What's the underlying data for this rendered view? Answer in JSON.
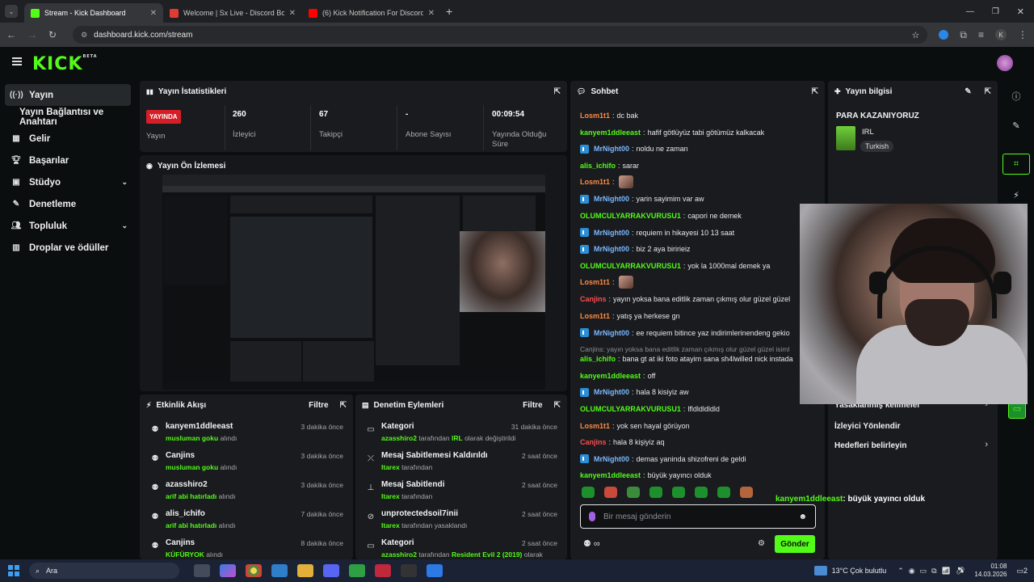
{
  "browser": {
    "tabs": [
      {
        "title": "Stream - Kick Dashboard",
        "icon": "kick-icon",
        "color": "#53fc18",
        "active": true
      },
      {
        "title": "Welcome | Sx Live - Discord Bot",
        "icon": "bot-icon",
        "color": "#e03c31",
        "active": false
      },
      {
        "title": "(6) Kick Notification For Discord",
        "icon": "youtube-icon",
        "color": "#ff0000",
        "active": false
      }
    ],
    "url": "dashboard.kick.com/stream"
  },
  "site": {
    "logo": "KICK",
    "logo_tag": "BETA",
    "accent": "#53fc18"
  },
  "sidebar": {
    "items": [
      {
        "label": "Yayın",
        "icon": "broadcast-icon"
      },
      {
        "label": "Yayın Bağlantısı ve Anahtarı",
        "icon": ""
      },
      {
        "label": "Gelir",
        "icon": "revenue-icon"
      },
      {
        "label": "Başarılar",
        "icon": "trophy-icon"
      },
      {
        "label": "Stüdyo",
        "icon": "studio-icon"
      },
      {
        "label": "Denetleme",
        "icon": "moderation-icon"
      },
      {
        "label": "Topluluk",
        "icon": "community-icon"
      },
      {
        "label": "Droplar ve ödüller",
        "icon": "drops-icon"
      }
    ]
  },
  "stats": {
    "title": "Yayın İstatistikleri",
    "live_badge": "YAYINDA",
    "live_label": "Yayın",
    "viewers": "260",
    "viewers_label": "İzleyici",
    "followers": "67",
    "followers_label": "Takipçi",
    "subs": "-",
    "subs_label": "Abone Sayısı",
    "uptime": "00:09:54",
    "uptime_label": "Yayında Olduğu Süre"
  },
  "preview": {
    "title": "Yayın Ön İzlemesi"
  },
  "feed": {
    "title": "Etkinlik Akışı",
    "filter": "Filtre",
    "items": [
      {
        "name": "kanyem1ddleeast",
        "user": "musluman goku",
        "action": "alındı",
        "time": "3 dakika önce"
      },
      {
        "name": "Canjins",
        "user": "musluman goku",
        "action": "alındı",
        "time": "3 dakika önce"
      },
      {
        "name": "azasshiro2",
        "user": "arif abi hatırladı",
        "action": "alındı",
        "time": "3 dakika önce"
      },
      {
        "name": "alis_ichifo",
        "user": "arif abi hatırladı",
        "action": "alındı",
        "time": "7 dakika önce"
      },
      {
        "name": "Canjins",
        "user": "KÜFÜRYOK",
        "action": "alındı",
        "time": "8 dakika önce"
      }
    ]
  },
  "modlog": {
    "title": "Denetim Eylemleri",
    "filter": "Filtre",
    "items": [
      {
        "title": "Kategori",
        "user": "azasshiro2",
        "mid": "tarafından",
        "val": "IRL",
        "rest": "olarak değiştirildi",
        "time": "31 dakika önce",
        "icon": "category-icon"
      },
      {
        "title": "Mesaj Sabitlemesi Kaldırıldı",
        "user": "Itarex",
        "mid": "tarafından",
        "val": "",
        "rest": "",
        "time": "2 saat önce",
        "icon": "unpin-icon"
      },
      {
        "title": "Mesaj Sabitlendi",
        "user": "Itarex",
        "mid": "tarafından",
        "val": "",
        "rest": "",
        "time": "2 saat önce",
        "icon": "pin-icon"
      },
      {
        "title": "unprotectedsoil7inii",
        "user": "Itarex",
        "mid": "tarafından yasaklandı",
        "val": "",
        "rest": "",
        "time": "2 saat önce",
        "icon": "ban-icon"
      },
      {
        "title": "Kategori",
        "user": "azasshiro2",
        "mid": "tarafından",
        "val": "Resident Evil 2 (2019)",
        "rest": "olarak",
        "time": "2 saat önce",
        "icon": "category-icon"
      }
    ]
  },
  "chat": {
    "title": "Sohbet",
    "messages": [
      {
        "name": "Losm1t1",
        "color": "#ff8a3d",
        "text": "dc bak",
        "badge": false,
        "emote": false
      },
      {
        "name": "kanyem1ddleeast",
        "color": "#53fc18",
        "text": "hafif götlüyüz tabi götümüz kalkacak",
        "badge": false,
        "emote": false
      },
      {
        "name": "MrNight00",
        "color": "#7cb8ff",
        "text": "noldu ne zaman",
        "badge": true,
        "emote": false
      },
      {
        "name": "alis_ichifo",
        "color": "#53fc18",
        "text": "sarar",
        "badge": false,
        "emote": false
      },
      {
        "name": "Losm1t1",
        "color": "#ff8a3d",
        "text": "",
        "badge": false,
        "emote": true
      },
      {
        "name": "MrNight00",
        "color": "#7cb8ff",
        "text": "yarin sayimim var aw",
        "badge": true,
        "emote": false
      },
      {
        "name": "OLUMCULYARRAKVURUSU1",
        "color": "#53fc18",
        "text": "capori ne demek",
        "badge": false,
        "emote": false
      },
      {
        "name": "MrNight00",
        "color": "#7cb8ff",
        "text": "requiem in hikayesi 10 13 saat",
        "badge": true,
        "emote": false
      },
      {
        "name": "MrNight00",
        "color": "#7cb8ff",
        "text": "biz 2 aya biririeiz",
        "badge": true,
        "emote": false
      },
      {
        "name": "OLUMCULYARRAKVURUSU1",
        "color": "#53fc18",
        "text": "yok la 1000mal demek ya",
        "badge": false,
        "emote": false
      },
      {
        "name": "Losm1t1",
        "color": "#ff8a3d",
        "text": "",
        "badge": false,
        "emote": true
      },
      {
        "name": "Canjins",
        "color": "#ff4d4d",
        "text": "yayın yoksa bana editlik zaman çıkmış olur güzel güzel",
        "badge": false,
        "emote": false
      },
      {
        "name": "Losm1t1",
        "color": "#ff8a3d",
        "text": "yatış ya herkese gn",
        "badge": false,
        "emote": false
      },
      {
        "name": "MrNight00",
        "color": "#7cb8ff",
        "text": "ee requiem bitince yaz indirimlerinendeng gekio",
        "badge": true,
        "emote": false
      },
      {
        "name": "alis_ichifo",
        "color": "#53fc18",
        "text": "bana gt at iki foto atayim sana sh4lwilled nick instada",
        "badge": false,
        "emote": false,
        "reply": "Canjins: yayın yoksa bana editlik zaman çıkmış olur güzel güzel isiml"
      },
      {
        "name": "kanyem1ddleeast",
        "color": "#53fc18",
        "text": "off",
        "badge": false,
        "emote": false
      },
      {
        "name": "MrNight00",
        "color": "#7cb8ff",
        "text": "hala 8 kisiyiz aw",
        "badge": true,
        "emote": false
      },
      {
        "name": "OLUMCULYARRAKVURUSU1",
        "color": "#53fc18",
        "text": "lfldldldldld",
        "badge": false,
        "emote": false
      },
      {
        "name": "Losm1t1",
        "color": "#ff8a3d",
        "text": "yok sen hayal görüyon",
        "badge": false,
        "emote": false
      },
      {
        "name": "Canjins",
        "color": "#ff4d4d",
        "text": "hala 8 kişiyiz aq",
        "badge": false,
        "emote": false
      },
      {
        "name": "MrNight00",
        "color": "#7cb8ff",
        "text": "demas yaninda shizofreni de geldi",
        "badge": true,
        "emote": false
      },
      {
        "name": "kanyem1ddleeast",
        "color": "#53fc18",
        "text": "büyük yayıncı olduk",
        "badge": false,
        "emote": false
      }
    ],
    "placeholder": "Bir mesaj gönderin",
    "send": "Gönder"
  },
  "info": {
    "title": "Yayın bilgisi",
    "stream_title": "PARA KAZANIYORUZ",
    "category": "IRL",
    "tag": "Turkish",
    "actions": [
      "Yasaklanmış kelimeler",
      "İzleyici Yönlendir",
      "Hedefleri belirleyin"
    ]
  },
  "overlay": {
    "name": "kanyem1ddleeast",
    "text": ": büyük yayıncı olduk"
  },
  "taskbar": {
    "search": "Ara",
    "weather": "13°C  Çok bulutlu",
    "time": "01:08",
    "date": "14.03.2026",
    "notifications": "2"
  }
}
